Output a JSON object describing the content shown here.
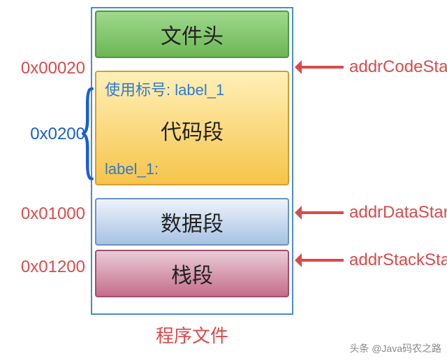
{
  "segments": {
    "header": "文件头",
    "code": "代码段",
    "code_label_use": "使用标号: label_1",
    "code_label_def": "label_1:",
    "data": "数据段",
    "stack": "栈段"
  },
  "addresses": {
    "codeStart": "0x00020",
    "codeOffset": "0x0200",
    "dataStart": "0x01000",
    "stackStart": "0x01200"
  },
  "labels": {
    "addrCodeStart": "addrCodeStart",
    "addrDataStart": "addrDataStart",
    "addrStackStart": "addrStackStart"
  },
  "caption": "程序文件",
  "watermark": "头条 @Java码农之路"
}
